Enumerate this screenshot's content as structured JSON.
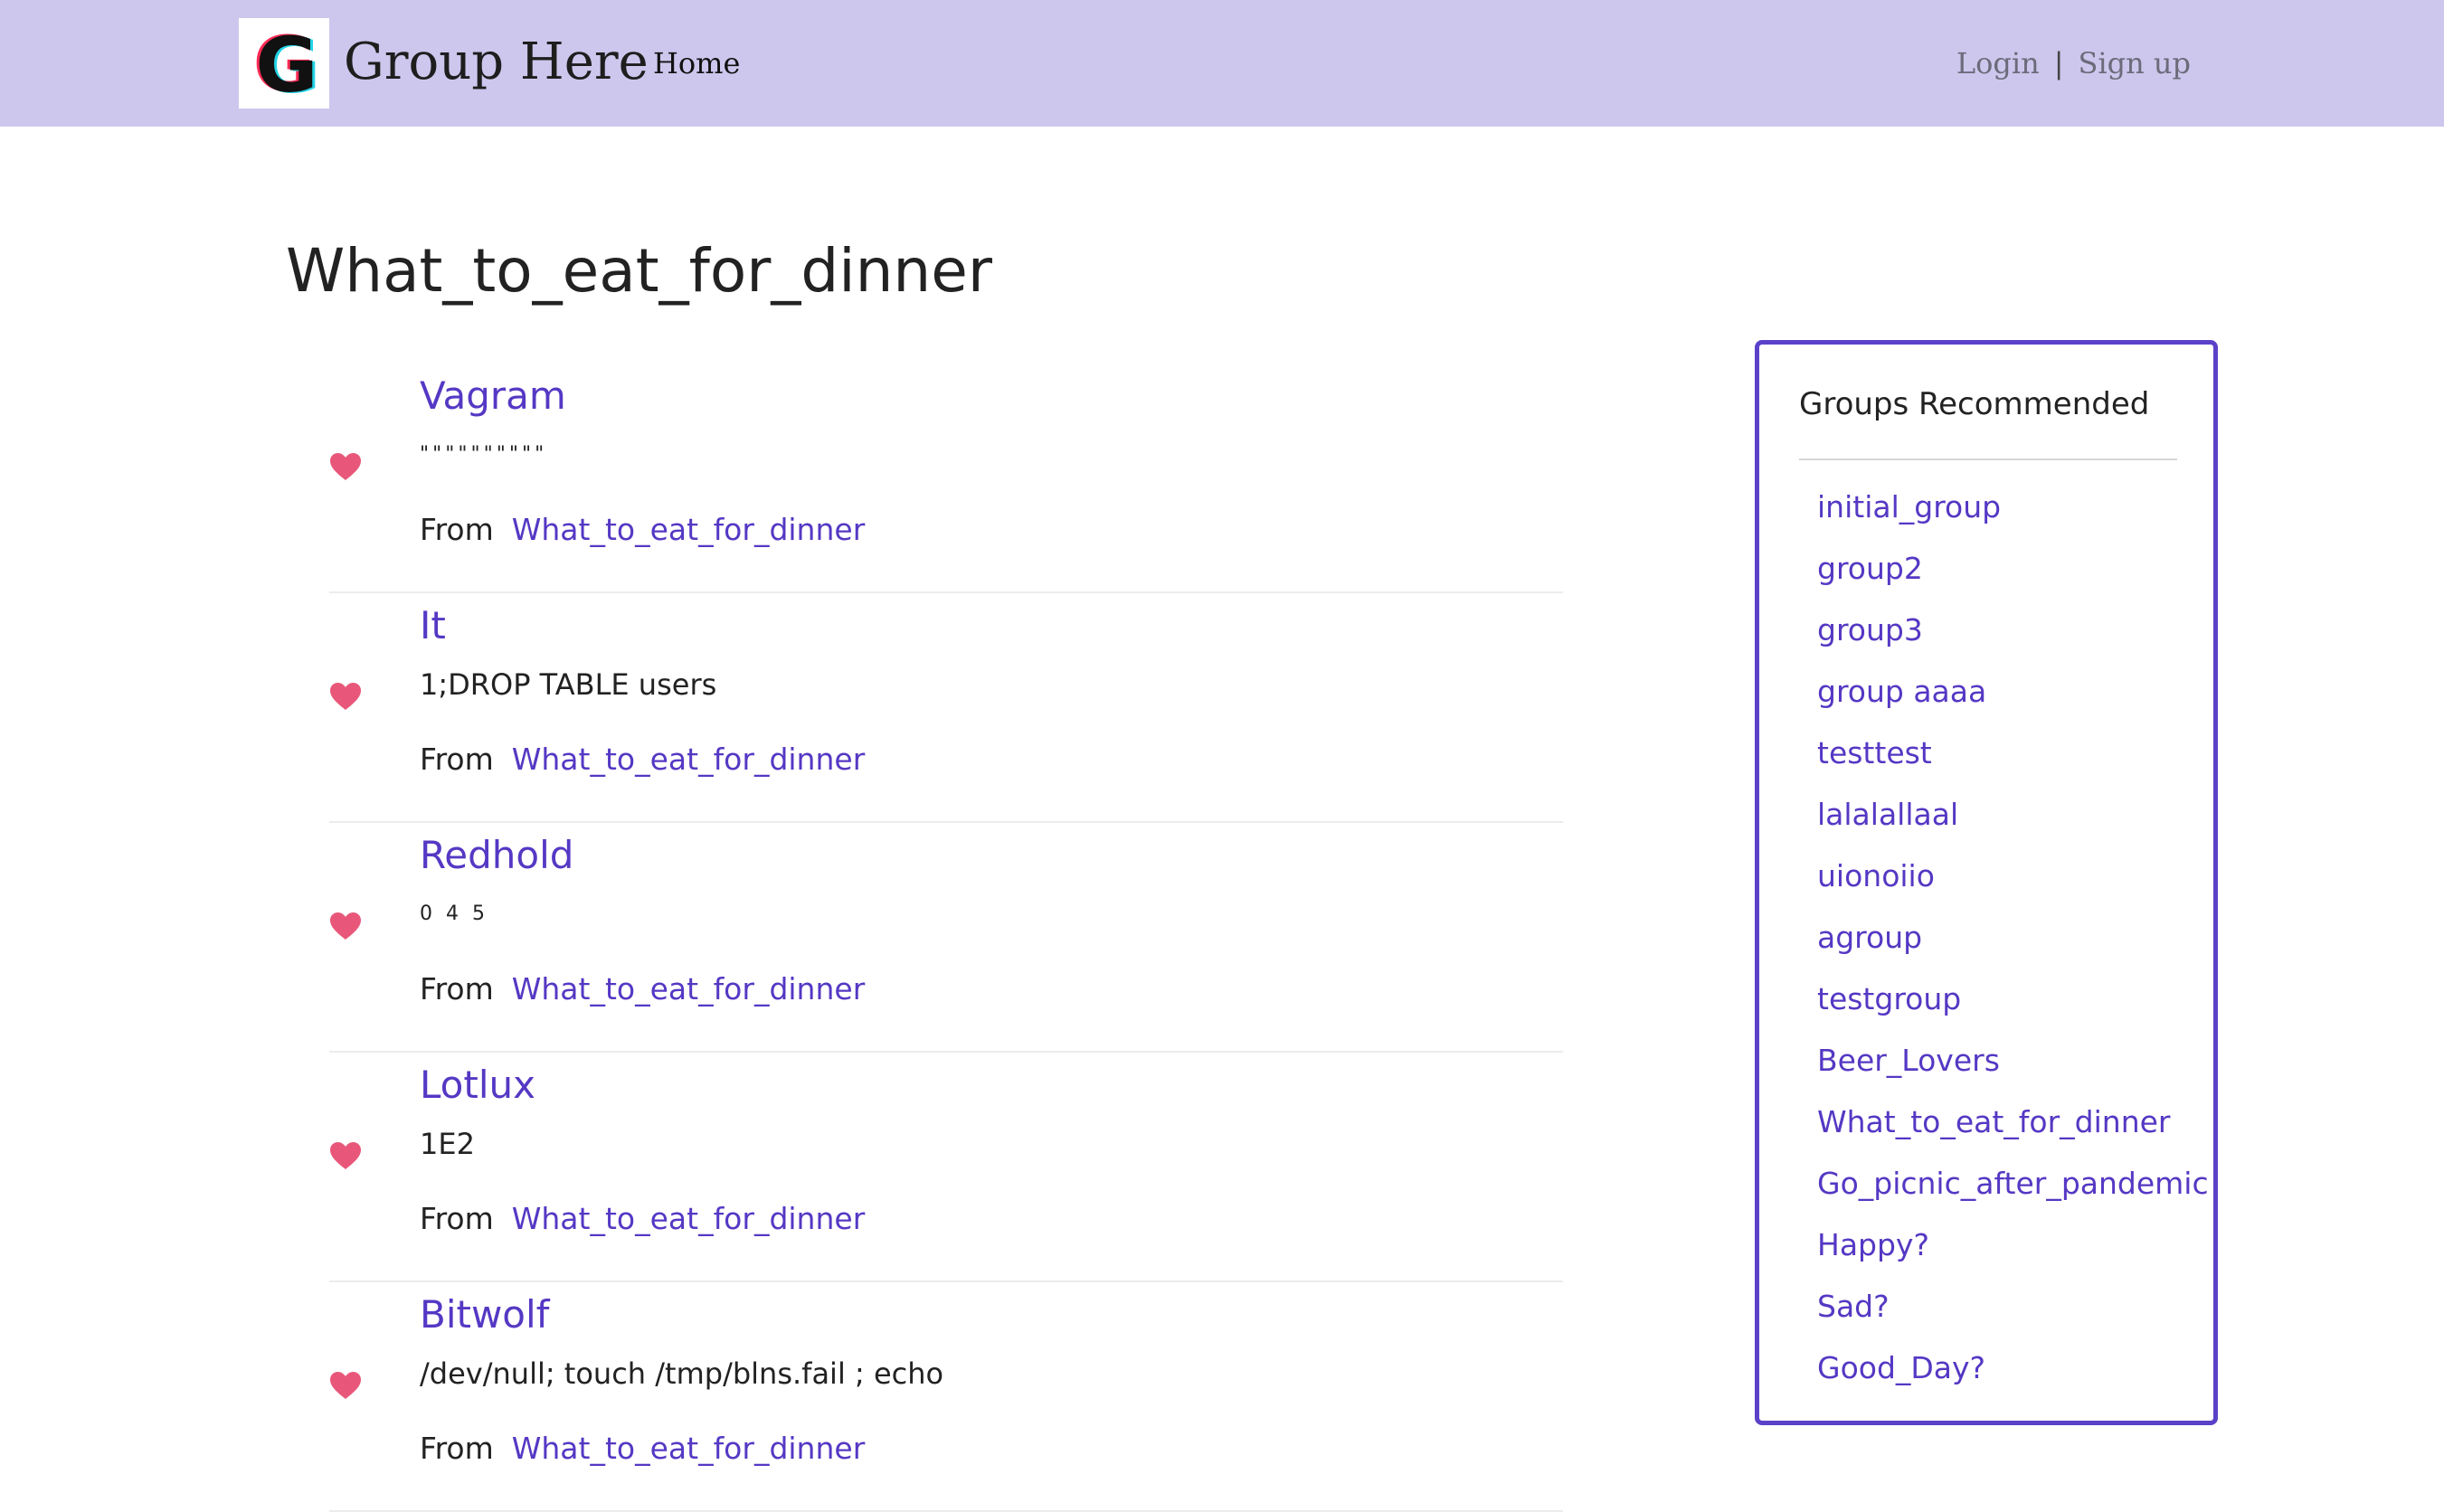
{
  "header": {
    "brand": "Group Here",
    "home_label": "Home",
    "login_label": "Login",
    "separator": "|",
    "signup_label": "Sign up",
    "accent_color": "#cdc7ed"
  },
  "page": {
    "title": "What_to_eat_for_dinner"
  },
  "posts": [
    {
      "author": "Vagram",
      "content": "\"\"\"\"\"\"\"\"\"\"",
      "from_label": "From",
      "group": "What_to_eat_for_dinner"
    },
    {
      "author": "It",
      "content": "1;DROP TABLE users",
      "from_label": "From",
      "group": "What_to_eat_for_dinner"
    },
    {
      "author": "Redhold",
      "content": "0 4 5",
      "from_label": "From",
      "group": "What_to_eat_for_dinner"
    },
    {
      "author": "Lotlux",
      "content": "1E2",
      "from_label": "From",
      "group": "What_to_eat_for_dinner"
    },
    {
      "author": "Bitwolf",
      "content": "/dev/null; touch /tmp/blns.fail ; echo",
      "from_label": "From",
      "group": "What_to_eat_for_dinner"
    }
  ],
  "sidebar": {
    "title": "Groups Recommended",
    "groups": [
      "initial_group",
      "group2",
      "group3",
      "group aaaa",
      "testtest",
      "lalalallaal",
      "uionoiio",
      "agroup",
      "testgroup",
      "Beer_Lovers",
      "What_to_eat_for_dinner",
      "Go_picnic_after_pandemic",
      "Happy?",
      "Sad?",
      "Good_Day?"
    ]
  },
  "icons": {
    "logo": "g-logo-icon",
    "like": "heart-icon",
    "heart_color": "#e8577a",
    "link_color": "#5538c4"
  }
}
